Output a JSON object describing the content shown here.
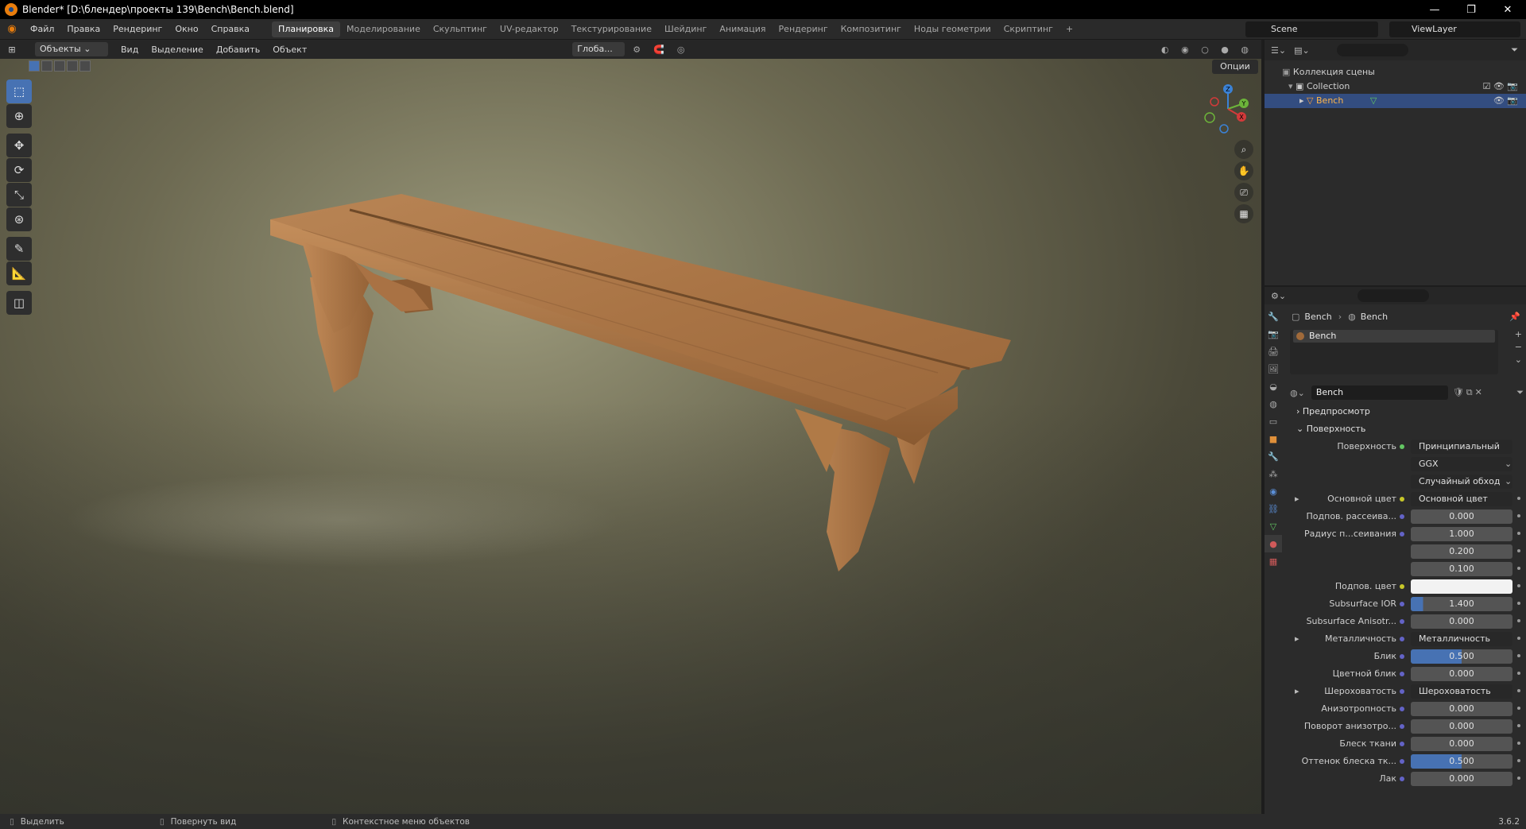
{
  "window": {
    "title": "Blender* [D:\\блендер\\проекты 139\\Bench\\Bench.blend]",
    "minimize": "—",
    "maximize": "❐",
    "close": "✕"
  },
  "menu": [
    "Файл",
    "Правка",
    "Рендеринг",
    "Окно",
    "Справка"
  ],
  "workspaces": [
    {
      "label": "Планировка",
      "active": true
    },
    {
      "label": "Моделирование"
    },
    {
      "label": "Скульптинг"
    },
    {
      "label": "UV-редактор"
    },
    {
      "label": "Текстурирование"
    },
    {
      "label": "Шейдинг"
    },
    {
      "label": "Анимация"
    },
    {
      "label": "Рендеринг"
    },
    {
      "label": "Композитинг"
    },
    {
      "label": "Ноды геометрии"
    },
    {
      "label": "Скриптинг"
    },
    {
      "label": "+"
    }
  ],
  "scene": "Scene",
  "view_layer": "ViewLayer",
  "viewport_header": {
    "mode": "Объекты",
    "menus": [
      "Вид",
      "Выделение",
      "Добавить",
      "Объект"
    ],
    "orientation": "Глоба...",
    "options": "Опции"
  },
  "gizmo": {
    "z": "Z",
    "y": "Y",
    "x": "X"
  },
  "outliner": {
    "scene_collection": "Коллекция сцены",
    "collection": "Collection",
    "object": "Bench"
  },
  "properties": {
    "breadcrumb_object": "Bench",
    "breadcrumb_material": "Bench",
    "material_slot": "Bench",
    "material_name": "Bench",
    "preview_label": "Предпросмотр",
    "surface_section": "Поверхность",
    "rows": [
      {
        "label": "Поверхность",
        "value": "Принципиальный BSDF",
        "kind": "link",
        "dot": "g"
      },
      {
        "label": "",
        "value": "GGX",
        "kind": "select"
      },
      {
        "label": "",
        "value": "Случайный обход",
        "kind": "select"
      },
      {
        "label": "Основной цвет",
        "value": "Основной цвет",
        "kind": "link",
        "dot": "y",
        "expand": true
      },
      {
        "label": "Подпов. рассеива...",
        "value": "0.000",
        "kind": "num",
        "dot": "b"
      },
      {
        "label": "Радиус п...сеивания",
        "value": "1.000",
        "kind": "num",
        "dot": "b"
      },
      {
        "label": "",
        "value": "0.200",
        "kind": "num"
      },
      {
        "label": "",
        "value": "0.100",
        "kind": "num"
      },
      {
        "label": "Подпов. цвет",
        "value": "",
        "kind": "color",
        "dot": "y"
      },
      {
        "label": "Subsurface IOR",
        "value": "1.400",
        "kind": "bar",
        "fill": 0.12,
        "dot": "b"
      },
      {
        "label": "Subsurface Anisotr...",
        "value": "0.000",
        "kind": "num",
        "dot": "b"
      },
      {
        "label": "Металличность",
        "value": "Металличность",
        "kind": "link",
        "dot": "b",
        "expand": true
      },
      {
        "label": "Блик",
        "value": "0.500",
        "kind": "bar",
        "fill": 0.5,
        "dot": "b"
      },
      {
        "label": "Цветной блик",
        "value": "0.000",
        "kind": "num",
        "dot": "b"
      },
      {
        "label": "Шероховатость",
        "value": "Шероховатость",
        "kind": "link",
        "dot": "b",
        "expand": true
      },
      {
        "label": "Анизотропность",
        "value": "0.000",
        "kind": "num",
        "dot": "b"
      },
      {
        "label": "Поворот анизотро...",
        "value": "0.000",
        "kind": "num",
        "dot": "b"
      },
      {
        "label": "Блеск ткани",
        "value": "0.000",
        "kind": "num",
        "dot": "b"
      },
      {
        "label": "Оттенок блеска тк...",
        "value": "0.500",
        "kind": "bar",
        "fill": 0.5,
        "dot": "b"
      },
      {
        "label": "Лак",
        "value": "0.000",
        "kind": "num",
        "dot": "b"
      }
    ]
  },
  "status": {
    "select": "Выделить",
    "rotate": "Повернуть вид",
    "context": "Контекстное меню объектов",
    "version": "3.6.2"
  },
  "colors": {
    "accent": "#4772b3",
    "selected_text": "#ffb64a",
    "wood": "#b07a47"
  }
}
